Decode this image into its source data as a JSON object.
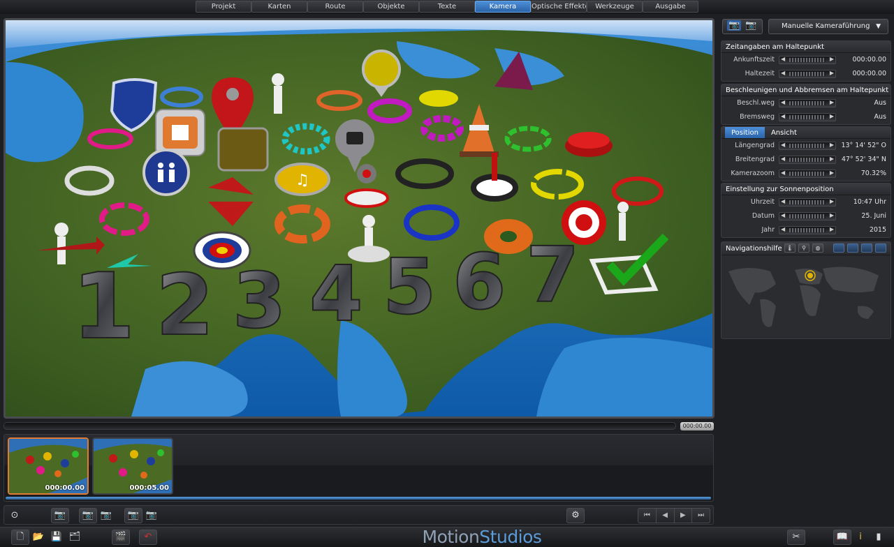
{
  "menu": {
    "tabs": [
      {
        "label": "Projekt"
      },
      {
        "label": "Karten"
      },
      {
        "label": "Route"
      },
      {
        "label": "Objekte"
      },
      {
        "label": "Texte"
      },
      {
        "label": "Kamera"
      },
      {
        "label": "Optische Effekte"
      },
      {
        "label": "Werkzeuge"
      },
      {
        "label": "Ausgabe"
      }
    ],
    "active": "Kamera"
  },
  "viewport": {
    "numbers_label": "1234567",
    "icons": [
      "shield-icon",
      "museum-icon",
      "toilet-icon",
      "map-pin-icon",
      "camera-pin-icon",
      "music-note-icon",
      "traffic-cone-icon",
      "target-icon",
      "checkmark-icon",
      "arrow-icon",
      "stick-figure-icon",
      "red-button-icon"
    ]
  },
  "timeline": {
    "timecode": "000:00.00",
    "thumbnails": [
      {
        "time": "000:00.00",
        "selected": true
      },
      {
        "time": "000:05.00",
        "selected": false
      }
    ]
  },
  "branding": {
    "logo_left": "Motion",
    "logo_right": "Studios"
  },
  "camera": {
    "mode_label": "Manuelle Kameraführung",
    "stop_timing": {
      "title": "Zeitangaben am Haltepunkt",
      "rows": [
        {
          "label": "Ankunftszeit",
          "value": "000:00.00"
        },
        {
          "label": "Haltezeit",
          "value": "000:00.00"
        }
      ]
    },
    "accel": {
      "title": "Beschleunigen und Abbremsen am Haltepunkt",
      "rows": [
        {
          "label": "Beschl.weg",
          "value": "Aus"
        },
        {
          "label": "Bremsweg",
          "value": "Aus"
        }
      ]
    },
    "position": {
      "tabs": [
        "Position",
        "Ansicht"
      ],
      "rows": [
        {
          "label": "Längengrad",
          "value": "13° 14' 52\" O"
        },
        {
          "label": "Breitengrad",
          "value": "47° 52' 34\" N"
        },
        {
          "label": "Kamerazoom",
          "value": "70.32%"
        }
      ]
    },
    "sun": {
      "title": "Einstellung zur Sonnenposition",
      "rows": [
        {
          "label": "Uhrzeit",
          "value": "10:47 Uhr"
        },
        {
          "label": "Datum",
          "value": "25. Juni"
        },
        {
          "label": "Jahr",
          "value": "2015"
        }
      ]
    },
    "nav": {
      "title": "Navigationshilfe"
    }
  },
  "colors": {
    "accent": "#3a78c4",
    "selected_thumb": "#e07b32"
  }
}
